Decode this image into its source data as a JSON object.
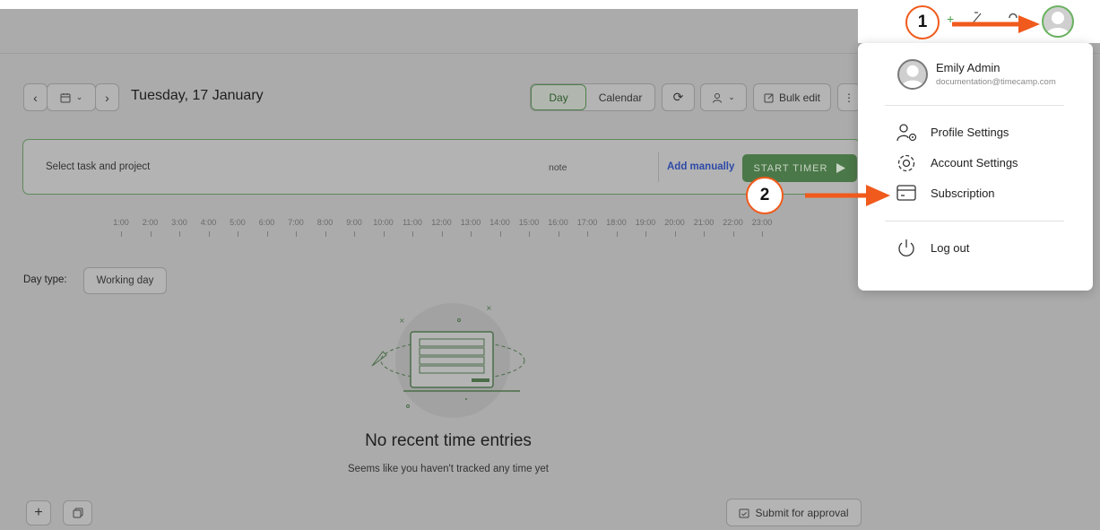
{
  "toolbar": {
    "date_label": "Tuesday, 17 January",
    "view_day": "Day",
    "view_calendar": "Calendar",
    "bulk_edit": "Bulk edit"
  },
  "timer": {
    "task_placeholder": "Select task and project",
    "note_placeholder": "note",
    "add_manually": "Add manually",
    "start_timer": "START TIMER"
  },
  "timeline": {
    "hours": [
      "1:00",
      "2:00",
      "3:00",
      "4:00",
      "5:00",
      "6:00",
      "7:00",
      "8:00",
      "9:00",
      "10:00",
      "11:00",
      "12:00",
      "13:00",
      "14:00",
      "15:00",
      "16:00",
      "17:00",
      "18:00",
      "19:00",
      "20:00",
      "21:00",
      "22:00",
      "23:00"
    ]
  },
  "daytype": {
    "label": "Day type:",
    "value": "Working day"
  },
  "empty": {
    "title": "No recent time entries",
    "subtitle": "Seems like you haven't tracked any time yet"
  },
  "footer": {
    "submit": "Submit for approval"
  },
  "user_menu": {
    "name": "Emily Admin",
    "email": "documentation@timecamp.com",
    "items": [
      {
        "label": "Profile Settings",
        "icon": "profile-settings-icon"
      },
      {
        "label": "Account Settings",
        "icon": "gear-icon"
      },
      {
        "label": "Subscription",
        "icon": "credit-card-icon"
      }
    ],
    "logout": "Log out"
  },
  "annotations": {
    "step1": "1",
    "step2": "2",
    "accent": "#f05a1c"
  },
  "colors": {
    "brand_green": "#4b7848",
    "overlay": "#ababab"
  }
}
